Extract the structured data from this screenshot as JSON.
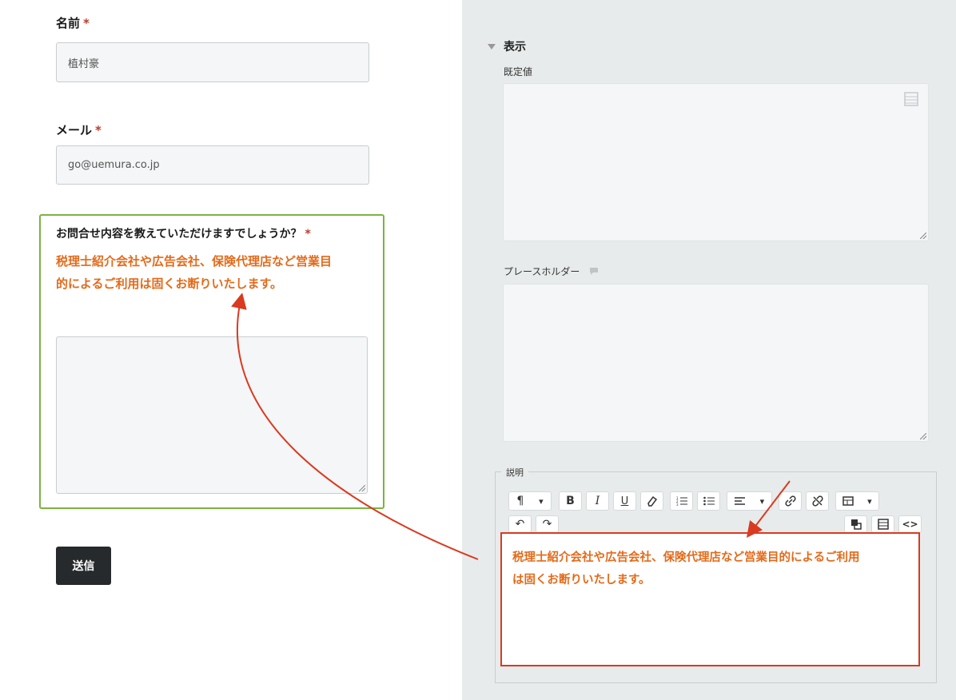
{
  "form": {
    "name_label": "名前",
    "name_value": "植村豪",
    "email_label": "メール",
    "email_value": "go@uemura.co.jp",
    "required_mark": "*",
    "inquiry_label": "お問合せ内容を教えていただけますでしょうか？",
    "inquiry_description_line1": "税理士紹介会社や広告会社、保険代理店など営業目",
    "inquiry_description_line2": "的によるご利用は固くお断りいたします。",
    "submit_label": "送信"
  },
  "settings": {
    "section_title": "表示",
    "default_value_label": "既定値",
    "placeholder_label": "プレースホルダー",
    "description_legend": "説明",
    "description_text_line1": "税理士紹介会社や広告会社、保険代理店など営業目的によるご利用",
    "description_text_line2": "は固くお断りいたします。"
  },
  "toolbar": {
    "paragraph": "¶",
    "bold": "B",
    "italic": "I",
    "underline": "U",
    "dropdown_caret": "▾",
    "undo": "↶",
    "redo": "↷",
    "source": "<>"
  },
  "colors": {
    "accent_orange": "#e36a1a",
    "annotation_red": "#d93a20",
    "focus_green": "#7cb342",
    "panel_bg": "#e8ebeb",
    "submit_bg": "#272a2c"
  }
}
